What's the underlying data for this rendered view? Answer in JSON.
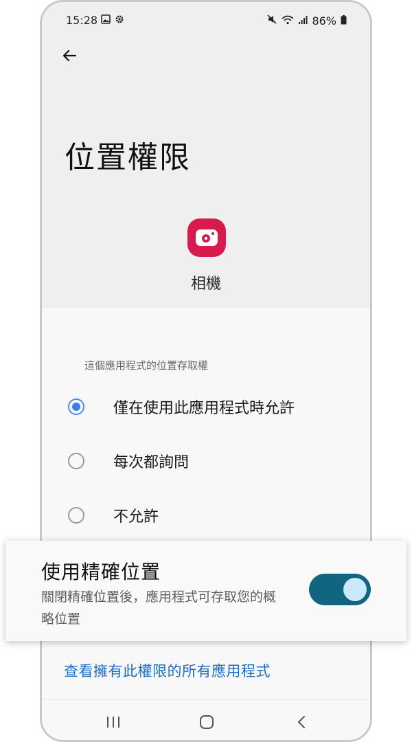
{
  "status_bar": {
    "time": "15:28",
    "battery": "86%",
    "icons": [
      "image-icon",
      "gear-icon",
      "mute-icon",
      "wifi-icon",
      "signal-icon",
      "battery-icon"
    ]
  },
  "header": {
    "back_icon": "arrow-left-icon",
    "title": "位置權限"
  },
  "app": {
    "icon": "camera-icon",
    "icon_color": "#d81b4f",
    "name": "相機"
  },
  "location_access": {
    "section_label": "這個應用程式的位置存取權",
    "options": [
      {
        "label": "僅在使用此應用程式時允許",
        "selected": true
      },
      {
        "label": "每次都詢問",
        "selected": false
      },
      {
        "label": "不允許",
        "selected": false
      }
    ]
  },
  "precise_location": {
    "title": "使用精確位置",
    "description": "關閉精確位置後，應用程式可存取您的概略位置",
    "enabled": true,
    "toggle_color": "#12657f"
  },
  "link": {
    "label": "查看擁有此權限的所有應用程式",
    "color": "#1a6fc4"
  },
  "nav_bar": {
    "buttons": [
      "recents-icon",
      "home-icon",
      "back-icon"
    ]
  }
}
